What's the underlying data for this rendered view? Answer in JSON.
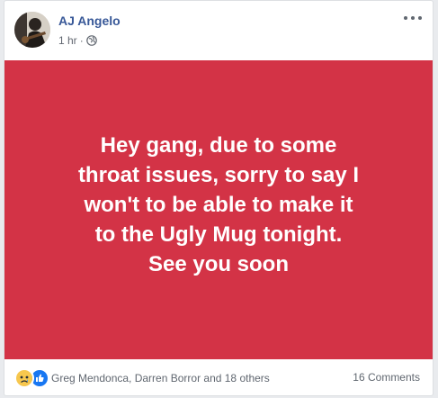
{
  "post": {
    "author_name": "AJ Angelo",
    "time": "1 hr",
    "separator": "·",
    "status_lines": [
      "Hey gang, due to some",
      "throat issues, sorry to say I",
      "won't to be able to make it",
      "to the Ugly Mug tonight.",
      "See you soon"
    ],
    "background_color": "#d33346"
  },
  "footer": {
    "reaction_icons": [
      "sad-reaction-icon",
      "like-reaction-icon"
    ],
    "reacted_names": "Greg Mendonca, Darren Borror and 18 others",
    "comments_count": "16 Comments"
  },
  "colors": {
    "author_link": "#385898",
    "meta_text": "#616770",
    "like_blue": "#1877f2",
    "sad_yellow": "#f7c74e"
  }
}
